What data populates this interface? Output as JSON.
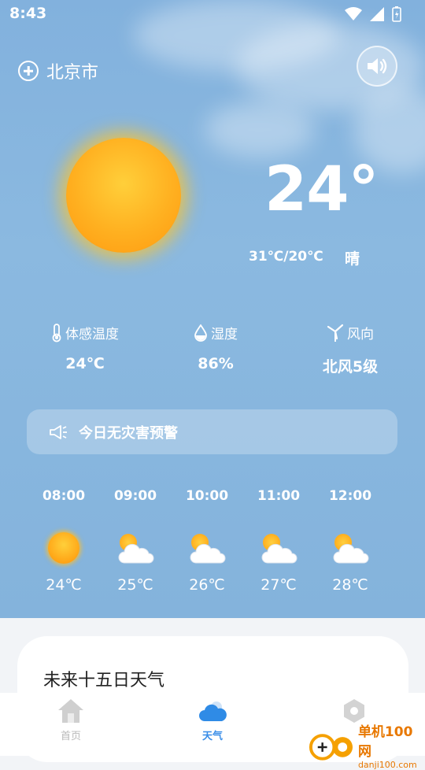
{
  "status_bar": {
    "time": "8:43"
  },
  "header": {
    "city": "北京市"
  },
  "current": {
    "temperature": "24°",
    "range": "31℃/20℃",
    "condition": "晴"
  },
  "stats": [
    {
      "label": "体感温度",
      "value": "24℃",
      "icon": "thermometer-icon"
    },
    {
      "label": "湿度",
      "value": "86%",
      "icon": "humidity-drop-icon"
    },
    {
      "label": "风向",
      "value": "北风5级",
      "icon": "wind-turbine-icon"
    }
  ],
  "alert": {
    "text": "今日无灾害预警",
    "icon": "megaphone-icon"
  },
  "hourly": [
    {
      "time": "08:00",
      "temp": "24℃",
      "icon": "sunny"
    },
    {
      "time": "09:00",
      "temp": "25℃",
      "icon": "partly-cloudy"
    },
    {
      "time": "10:00",
      "temp": "26℃",
      "icon": "partly-cloudy"
    },
    {
      "time": "11:00",
      "temp": "27℃",
      "icon": "partly-cloudy"
    },
    {
      "time": "12:00",
      "temp": "28℃",
      "icon": "partly-cloudy"
    }
  ],
  "forecast_card": {
    "title": "未来十五日天气"
  },
  "tabs": [
    {
      "label": "首页",
      "icon": "home-icon",
      "active": false
    },
    {
      "label": "天气",
      "icon": "cloud-icon",
      "active": true
    },
    {
      "label": "",
      "icon": "settings-hexagon-icon",
      "active": false
    }
  ],
  "watermark": {
    "title": "单机100网",
    "url": "danji100.com"
  },
  "colors": {
    "sky": "#84b3dc",
    "accent": "#3a8ee8",
    "sun": "#ffb020"
  }
}
